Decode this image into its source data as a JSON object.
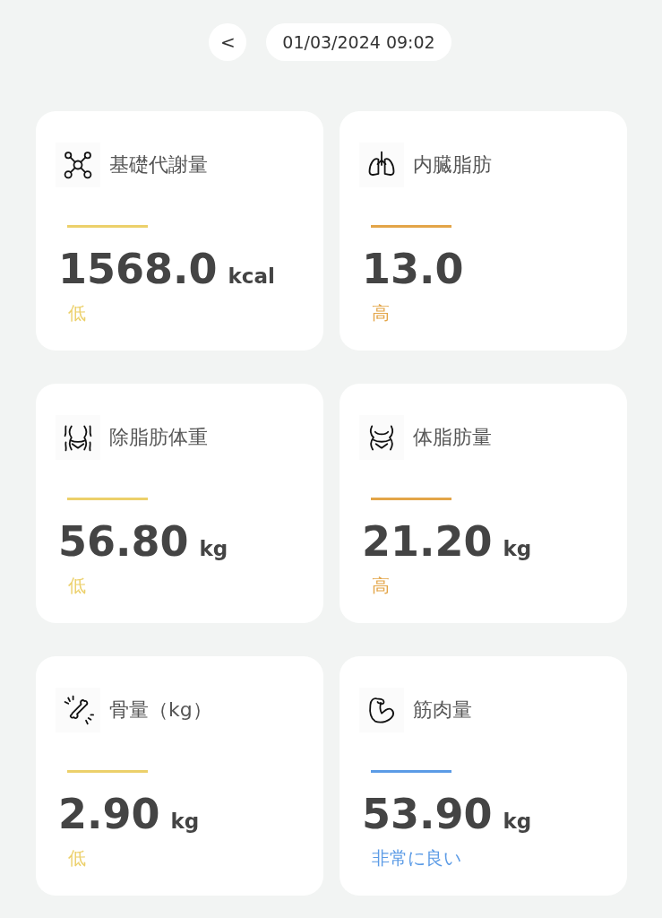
{
  "header": {
    "back_label": "<",
    "datetime": "01/03/2024 09:02"
  },
  "metrics": [
    {
      "title": "基礎代謝量",
      "value": "1568.0",
      "unit": "kcal",
      "status": "低",
      "color": "#ecd06a"
    },
    {
      "title": "内臓脂肪",
      "value": "13.0",
      "status": "高",
      "color": "#e3a548"
    },
    {
      "title": "除脂肪体重",
      "value": "56.80",
      "unit": "kg",
      "status": "低",
      "color": "#ecd06a"
    },
    {
      "title": "体脂肪量",
      "value": "21.20",
      "unit": "kg",
      "status": "高",
      "color": "#e3a548"
    },
    {
      "title": "骨量（kg）",
      "value": "2.90",
      "unit": "kg",
      "status": "低",
      "color": "#ecd06a"
    },
    {
      "title": "筋肉量",
      "value": "53.90",
      "unit": "kg",
      "status": "非常に良い",
      "color": "#5b9be6"
    }
  ]
}
